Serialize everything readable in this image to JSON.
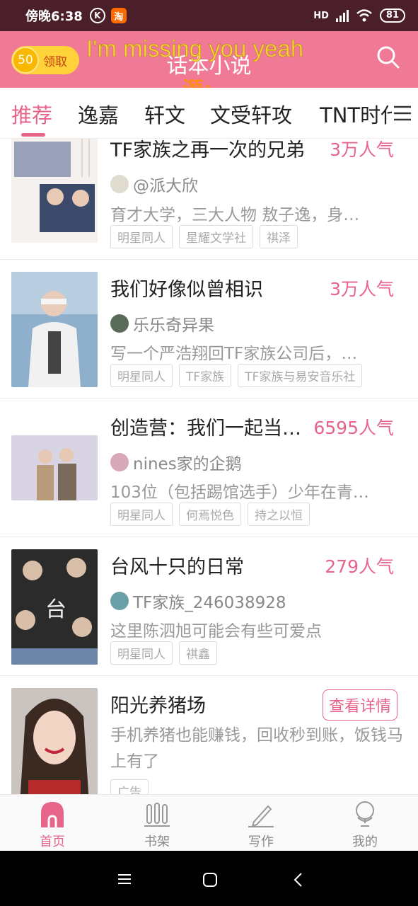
{
  "status_bar": {
    "time": "傍晚6:38",
    "k_icon": "K",
    "taobao_icon": "淘",
    "network": "HD",
    "battery": "81"
  },
  "header": {
    "coin_value": "50",
    "coin_label": "领取",
    "title": "话本小说",
    "overlay_lyric": "I'm missing you yeah",
    "overlay_source": "源:"
  },
  "tabs": [
    {
      "label": "推荐"
    },
    {
      "label": "逸嘉"
    },
    {
      "label": "轩文"
    },
    {
      "label": "文受轩攻"
    },
    {
      "label": "TNT时代"
    }
  ],
  "feed": [
    {
      "title": "TF家族之再一次的兄弟",
      "popularity": "3万人气",
      "author": "@派大欣",
      "description": "育才大学，三大人物 敖子逸，身…",
      "tags": [
        "明星同人",
        "星耀文学社",
        "祺泽"
      ]
    },
    {
      "title": "我们好像似曾相识",
      "popularity": "3万人气",
      "author": "乐乐奇异果",
      "description": "写一个严浩翔回TF家族公司后，…",
      "tags": [
        "明星同人",
        "TF家族",
        "TF家族与易安音乐社"
      ]
    },
    {
      "title": "创造营：我们一起当…",
      "popularity": "6595人气",
      "author": "nines家的企鹅",
      "description": "103位（包括踢馆选手）少年在青…",
      "tags": [
        "明星同人",
        "何焉悦色",
        "持之以恒"
      ]
    },
    {
      "title": "台风十只的日常",
      "popularity": "279人气",
      "author": "TF家族_246038928",
      "description": "这里陈泗旭可能会有些可爱点",
      "tags": [
        "明星同人",
        "祺鑫"
      ]
    },
    {
      "title": "阳光养猪场",
      "button": "查看详情",
      "description": "手机养猪也能赚钱，回收秒到账，饭钱马上有了",
      "tags": [
        "广告"
      ]
    }
  ],
  "bottom_nav": [
    {
      "label": "首页",
      "icon": "home-icon",
      "active": true
    },
    {
      "label": "书架",
      "icon": "bookshelf-icon",
      "active": false
    },
    {
      "label": "写作",
      "icon": "pen-icon",
      "active": false
    },
    {
      "label": "我的",
      "icon": "profile-icon",
      "active": false
    }
  ],
  "colors": {
    "accent": "#e7648a",
    "header_bg": "#f07a96",
    "status_bar_bg": "#4a1f2a"
  }
}
